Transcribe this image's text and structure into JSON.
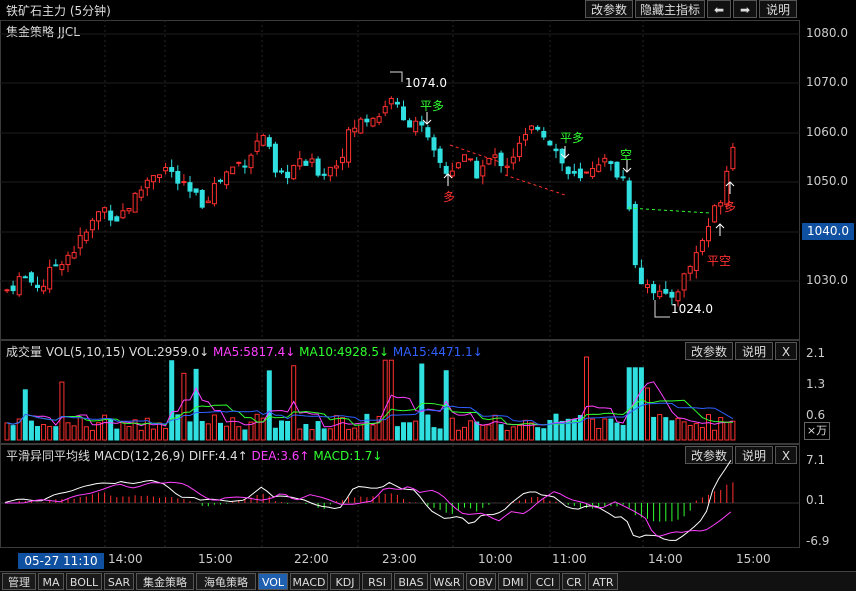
{
  "header": {
    "title": "铁矿石主力 (5分钟)",
    "buttons": [
      "改参数",
      "隐藏主指标",
      "⬅",
      "➡",
      "说明"
    ]
  },
  "main": {
    "strategy_label": "集金策略 JJCL",
    "price_axis": [
      "1080.0",
      "1070.0",
      "1060.0",
      "1050.0",
      "1040.0",
      "1030.0"
    ],
    "current_price": "1040.0",
    "high_label": "1074.0",
    "low_label": "1024.0",
    "signals": {
      "ping_duo_1": "平多",
      "ping_duo_2": "平多",
      "kong": "空",
      "duo_1": "多",
      "duo_2": "多",
      "ping_kong": "平空"
    },
    "colors": {
      "up": "#ff3030",
      "down": "#30e0e0",
      "accent": "#ffff00"
    }
  },
  "volume": {
    "label": "成交量",
    "vol_params": "VOL(5,10,15)",
    "vol_value": "VOL:2959.0↓",
    "ma5": "MA5:5817.4↓",
    "ma10": "MA10:4928.5↓",
    "ma15": "MA15:4471.1↓",
    "buttons": [
      "改参数",
      "说明",
      "X"
    ],
    "axis": [
      "2.1",
      "1.3",
      "0.6"
    ],
    "unit": "×万"
  },
  "macd": {
    "label": "平滑异同平均线",
    "params": "MACD(12,26,9)",
    "diff": "DIFF:4.4↑",
    "dea": "DEA:3.6↑",
    "macd_value": "MACD:1.7↓",
    "buttons": [
      "改参数",
      "说明",
      "X"
    ],
    "axis": [
      "7.1",
      "0.1",
      "-6.9"
    ]
  },
  "timebar": {
    "current": "05-27 11:10",
    "times": [
      "14:00",
      "15:00",
      "22:00",
      "23:00",
      "10:00",
      "11:00",
      "14:00",
      "15:00"
    ]
  },
  "tabs": [
    "管理",
    "MA",
    "BOLL",
    "SAR",
    "集金策略",
    "海龟策略",
    "VOL",
    "MACD",
    "KDJ",
    "RSI",
    "BIAS",
    "W&R",
    "OBV",
    "DMI",
    "CCI",
    "CR",
    "ATR"
  ]
}
